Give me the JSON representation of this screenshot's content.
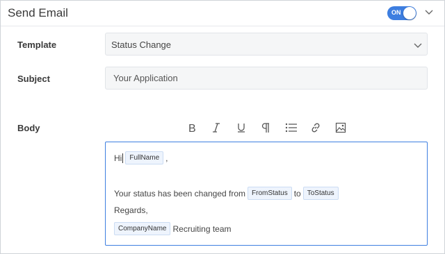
{
  "header": {
    "title": "Send Email",
    "toggle_label": "ON"
  },
  "form": {
    "template_label": "Template",
    "template_value": "Status Change",
    "subject_label": "Subject",
    "subject_value": "Your Application",
    "body_label": "Body"
  },
  "toolbar": {
    "items": [
      "bold-icon",
      "italic-icon",
      "underline-icon",
      "paragraph-icon",
      "list-icon",
      "link-icon",
      "image-icon"
    ]
  },
  "editor": {
    "greeting_prefix": "Hi",
    "fullname_tag": "FullName",
    "greeting_suffix": ",",
    "status_text": "Your status has been changed from",
    "from_status_tag": "FromStatus",
    "to_word": "to",
    "to_status_tag": "ToStatus",
    "regards": "Regards,",
    "company_tag": "CompanyName",
    "signature_text": "Recruiting team"
  },
  "colors": {
    "accent": "#3d7ee0",
    "chip_bg": "#eef4fd",
    "field_bg": "#f5f6f7"
  }
}
